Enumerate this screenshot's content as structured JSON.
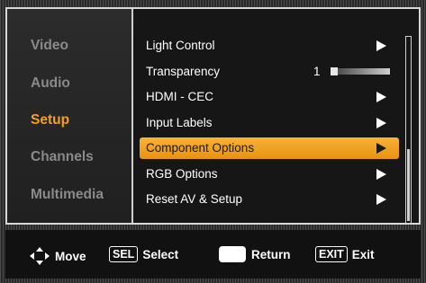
{
  "sidebar": {
    "items": [
      {
        "label": "Video",
        "active": false
      },
      {
        "label": "Audio",
        "active": false
      },
      {
        "label": "Setup",
        "active": true
      },
      {
        "label": "Channels",
        "active": false
      },
      {
        "label": "Multimedia",
        "active": false
      }
    ]
  },
  "menu": {
    "items": [
      {
        "label": "Light Control",
        "type": "submenu"
      },
      {
        "label": "Transparency",
        "type": "slider",
        "value": "1",
        "level": 0.0
      },
      {
        "label": "HDMI - CEC",
        "type": "submenu"
      },
      {
        "label": "Input Labels",
        "type": "submenu"
      },
      {
        "label": "Component Options",
        "type": "submenu",
        "selected": true
      },
      {
        "label": "RGB Options",
        "type": "submenu"
      },
      {
        "label": "Reset AV & Setup",
        "type": "submenu"
      }
    ]
  },
  "footer": {
    "move_label": "Move",
    "sel_key": "SEL",
    "select_label": "Select",
    "return_label": "Return",
    "exit_key": "EXIT",
    "exit_label": "Exit"
  },
  "colors": {
    "accent": "#f2a21b",
    "inactive_text": "#8a8a8a",
    "text": "#ffffff"
  },
  "icons": {
    "move": "four-way-arrow-icon",
    "submenu": "right-triangle-icon",
    "return": "return-key-icon"
  }
}
